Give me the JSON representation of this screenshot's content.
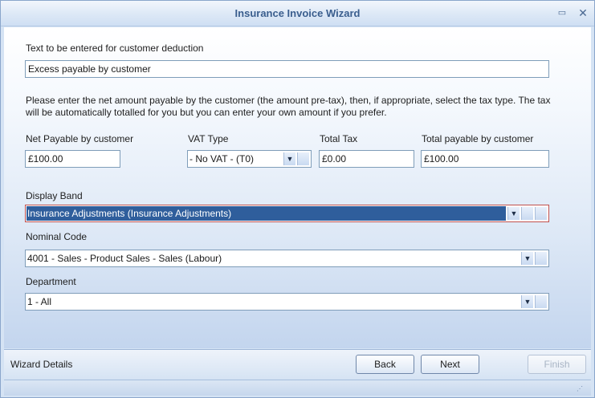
{
  "window": {
    "title": "Insurance Invoice Wizard"
  },
  "deduction": {
    "label": "Text to be entered for customer deduction",
    "value": "Excess payable by customer"
  },
  "instructions": "Please enter the net amount payable by the customer (the amount pre-tax), then, if appropriate, select the tax type.  The tax will be automatically totalled for you but you can enter your own amount if you prefer.",
  "amounts": {
    "net_label": "Net Payable by customer",
    "net_value": "£100.00",
    "vat_label": "VAT Type",
    "vat_value": "- No VAT - (T0)",
    "tax_label": "Total Tax",
    "tax_value": "£0.00",
    "total_label": "Total payable by customer",
    "total_value": "£100.00"
  },
  "display_band": {
    "label": "Display Band",
    "value": "Insurance Adjustments (Insurance Adjustments)"
  },
  "nominal_code": {
    "label": "Nominal Code",
    "value": "4001 - Sales - Product Sales - Sales (Labour)"
  },
  "department": {
    "label": "Department",
    "value": "1 - All"
  },
  "footer": {
    "details_label": "Wizard Details",
    "back_label": "Back",
    "next_label": "Next",
    "finish_label": "Finish"
  },
  "icons": {
    "restore": "restore-icon",
    "close": "close-icon",
    "dropdown": "chevron-down-icon",
    "grip": "resize-grip-icon"
  },
  "colors": {
    "title_text": "#3a5e8e",
    "selection": "#2f5e9c",
    "focus_border": "#c0504d"
  }
}
